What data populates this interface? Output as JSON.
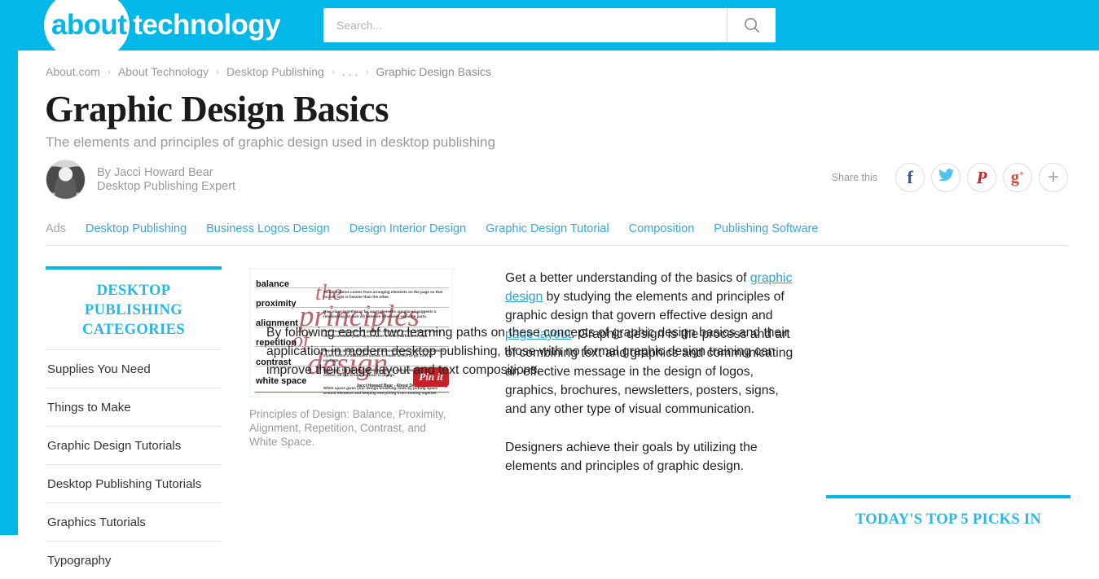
{
  "header": {
    "logo_about": "about",
    "logo_section": "technology",
    "search_placeholder": "Search...",
    "search_value": "",
    "search_icon": "search-icon"
  },
  "breadcrumb": [
    "About.com",
    "About Technology",
    "Desktop Publishing",
    ". . .",
    "Graphic Design Basics"
  ],
  "breadcrumb_separator": "›",
  "article": {
    "title": "Graphic Design Basics",
    "subtitle": "The elements and principles of graphic design used in desktop publishing",
    "author_line1": "By Jacci Howard Bear",
    "author_line2": "Desktop Publishing Expert"
  },
  "share": {
    "label": "Share this",
    "buttons": [
      {
        "name": "facebook",
        "glyph": "f",
        "color": "#3b5998"
      },
      {
        "name": "twitter",
        "glyph": "ᴠ",
        "color": "#4cc3f0"
      },
      {
        "name": "pinterest",
        "glyph": "P",
        "color": "#cb2027"
      },
      {
        "name": "googleplus",
        "glyph": "g+",
        "color": "#d34836"
      },
      {
        "name": "more",
        "glyph": "+",
        "color": "#a8a8a8"
      }
    ]
  },
  "ads": {
    "label": "Ads",
    "links": [
      "Desktop Publishing",
      "Business Logos Design",
      "Design Interior Design",
      "Graphic Design Tutorial",
      "Composition",
      "Publishing Software"
    ]
  },
  "sidebar": {
    "title": "DESKTOP PUBLISHING CATEGORIES",
    "items": [
      "Supplies You Need",
      "Things to Make",
      "Graphic Design Tutorials",
      "Desktop Publishing Tutorials",
      "Graphics Tutorials",
      "Typography"
    ]
  },
  "figure": {
    "caption": "Principles of Design: Balance, Proximity, Alignment, Repetition, Contrast, and White Space.",
    "pin_label": "Pin it",
    "credit": "Jacci Howard Bear - About Desktop Publishing",
    "script_lines": [
      "the",
      "principles",
      "of",
      "design"
    ],
    "rows": [
      {
        "term": "balance",
        "desc": "Visual balance comes from arranging elements on the page so that no one side is heavier than the other."
      },
      {
        "term": "proximity",
        "desc": "How close together or far apart elements are placed suggests a relationship (or lack of) between otherwise separate parts."
      },
      {
        "term": "alignment",
        "desc": "How you align type and graphics on a page and in relation to each other can make your layout easier or more difficult to read."
      },
      {
        "term": "repetition",
        "desc": "Repeating design elements and consistent use of type and graphics styles within a document shows a reader where to go, how to navigate."
      },
      {
        "term": "contrast",
        "desc": "In design, big and small elements, black and white text, squares and circles, all can create contrast in design."
      },
      {
        "term": "white space",
        "desc": "White space gives your design breathing room by putting space around elements and keeping everything from running together."
      }
    ]
  },
  "body": {
    "p1_part1": "Get a better understanding of the basics of ",
    "p1_link1": "graphic design",
    "p1_part2": " by studying the elements and principles of graphic design that govern effective design and ",
    "p1_link2": "page layout",
    "p1_part3": ". Graphic design is the process and art of combining text and graphics and communicating an effective message in the design of logos, graphics, brochures, newsletters, posters, signs, and any other type of visual communication.",
    "p2": "Designers achieve their goals by utilizing the elements and principles of graphic design.",
    "p3": "By following each of two learning paths on these concepts of graphic design basics and their application in modern desktop publishing, those with no formal graphic design training can improve their page layout and text compositions."
  },
  "right_rail": {
    "picks_title": "TODAY'S TOP 5 PICKS IN"
  },
  "colors": {
    "brand_cyan": "#02b8e8",
    "link_blue": "#29a3d6",
    "text_dark": "#222222",
    "muted_gray": "#9a9a9a"
  }
}
